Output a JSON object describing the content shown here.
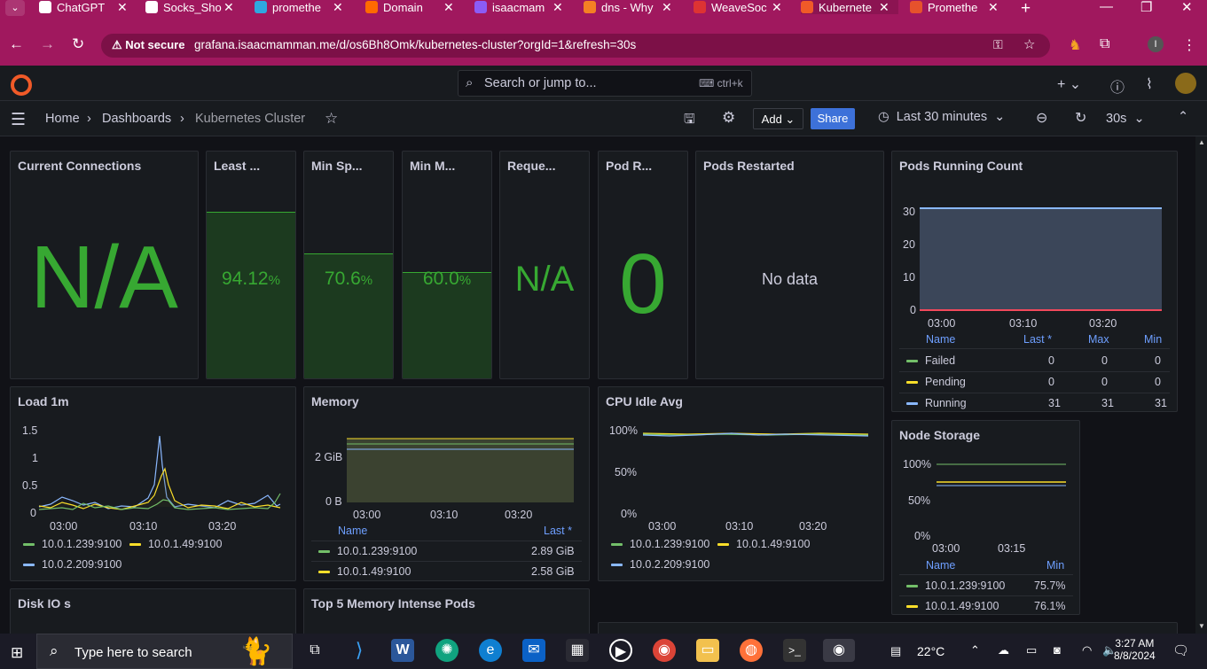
{
  "browser": {
    "tabs": [
      {
        "label": "ChatGPT",
        "color": "#fff",
        "x": 44,
        "w": 110,
        "active": false
      },
      {
        "label": "Socks_Sho",
        "color": "#fff",
        "x": 164,
        "w": 110,
        "active": false
      },
      {
        "label": "promethe",
        "color": "#2ea7e0",
        "x": 287,
        "w": 110,
        "active": false
      },
      {
        "label": "Domain",
        "color": "#ff6a00",
        "x": 412,
        "w": 110,
        "active": false
      },
      {
        "label": "isaacmam",
        "color": "#8b5cf6",
        "x": 535,
        "w": 110,
        "active": false
      },
      {
        "label": "dns - Why",
        "color": "#f48024",
        "x": 658,
        "w": 110,
        "active": false
      },
      {
        "label": "WeaveSoc",
        "color": "#d33",
        "x": 782,
        "w": 110,
        "active": false
      },
      {
        "label": "Kubernete",
        "color": "#f05a28",
        "x": 903,
        "w": 110,
        "active": true
      },
      {
        "label": "Promethe",
        "color": "#e6522c",
        "x": 1026,
        "w": 110,
        "active": false
      }
    ],
    "not_secure": "Not secure",
    "url": "grafana.isaacmamman.me/d/os6Bh8Omk/kubernetes-cluster?orgId=1&refresh=30s"
  },
  "topbar": {
    "search_placeholder": "Search or jump to...",
    "shortcut": "ctrl+k"
  },
  "breadcrumb": {
    "home": "Home",
    "dashboards": "Dashboards",
    "current": "Kubernetes Cluster"
  },
  "toolbar": {
    "add": "Add",
    "share": "Share",
    "timerange": "Last 30 minutes",
    "refresh": "30s"
  },
  "panels": {
    "current_connections": {
      "title": "Current Connections",
      "value": "N/A"
    },
    "least": {
      "title": "Least ...",
      "value": "94.12",
      "unit": "%",
      "fill": 0.9412
    },
    "min_sp": {
      "title": "Min Sp...",
      "value": "70.6",
      "unit": "%",
      "fill": 0.706
    },
    "min_m": {
      "title": "Min M...",
      "value": "60.0",
      "unit": "%",
      "fill": 0.6
    },
    "reque": {
      "title": "Reque...",
      "value": "N/A"
    },
    "pod_r": {
      "title": "Pod R...",
      "value": "0"
    },
    "pods_restarted": {
      "title": "Pods Restarted",
      "value": "No data"
    },
    "pods_running": {
      "title": "Pods Running Count",
      "y_ticks": [
        "30",
        "20",
        "10",
        "0"
      ],
      "x_ticks": [
        "03:00",
        "03:10",
        "03:20"
      ],
      "legend_head": [
        "Name",
        "Last *",
        "Max",
        "Min"
      ],
      "rows": [
        {
          "name": "Failed",
          "color": "#73bf69",
          "last": "0",
          "max": "0",
          "min": "0"
        },
        {
          "name": "Pending",
          "color": "#fade2a",
          "last": "0",
          "max": "0",
          "min": "0"
        },
        {
          "name": "Running",
          "color": "#8ab8ff",
          "last": "31",
          "max": "31",
          "min": "31"
        }
      ]
    },
    "load": {
      "title": "Load 1m",
      "y_ticks": [
        "1.5",
        "1",
        "0.5",
        "0"
      ],
      "x_ticks": [
        "03:00",
        "03:10",
        "03:20"
      ],
      "legend": [
        {
          "name": "10.0.1.239:9100",
          "color": "#73bf69"
        },
        {
          "name": "10.0.1.49:9100",
          "color": "#fade2a"
        },
        {
          "name": "10.0.2.209:9100",
          "color": "#8ab8ff"
        }
      ]
    },
    "memory": {
      "title": "Memory",
      "y_ticks": [
        "2 GiB",
        "0 B"
      ],
      "x_ticks": [
        "03:00",
        "03:10",
        "03:20"
      ],
      "legend_head": [
        "Name",
        "Last *"
      ],
      "rows": [
        {
          "name": "10.0.1.239:9100",
          "color": "#73bf69",
          "last": "2.89 GiB"
        },
        {
          "name": "10.0.1.49:9100",
          "color": "#fade2a",
          "last": "2.58 GiB"
        }
      ]
    },
    "cpu": {
      "title": "CPU Idle Avg",
      "y_ticks": [
        "100%",
        "50%",
        "0%"
      ],
      "x_ticks": [
        "03:00",
        "03:10",
        "03:20"
      ],
      "legend": [
        {
          "name": "10.0.1.239:9100",
          "color": "#73bf69"
        },
        {
          "name": "10.0.1.49:9100",
          "color": "#fade2a"
        },
        {
          "name": "10.0.2.209:9100",
          "color": "#8ab8ff"
        }
      ]
    },
    "node_storage": {
      "title": "Node Storage",
      "y_ticks": [
        "100%",
        "50%",
        "0%"
      ],
      "x_ticks": [
        "03:00",
        "03:15"
      ],
      "legend_head": [
        "Name",
        "Min"
      ],
      "rows": [
        {
          "name": "10.0.1.239:9100",
          "color": "#73bf69",
          "min": "75.7%"
        },
        {
          "name": "10.0.1.49:9100",
          "color": "#fade2a",
          "min": "76.1%"
        }
      ]
    },
    "disk_io": {
      "title": "Disk IO s"
    },
    "top5": {
      "title": "Top 5 Memory Intense Pods"
    }
  },
  "taskbar": {
    "search": "Type here to search",
    "temp": "22°C",
    "time": "3:27 AM",
    "date": "8/8/2024"
  }
}
